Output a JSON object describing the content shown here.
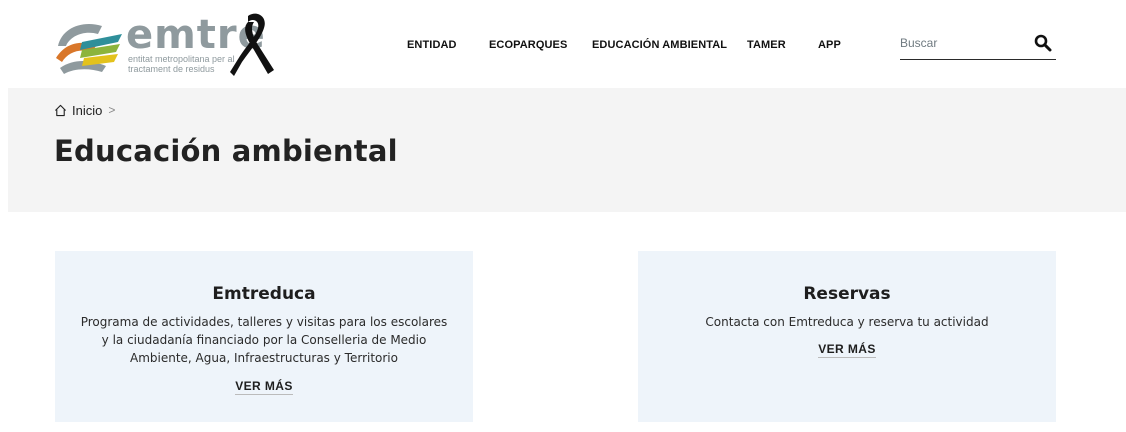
{
  "brand": {
    "name": "emtre",
    "tagline": "entitat metropolitana per al tractament de residus",
    "colors": {
      "gray": "#8f9a9e",
      "green": "#8cb43c",
      "orange": "#d9772a",
      "teal": "#2f8f9a",
      "yellow": "#e3c21c",
      "ribbon": "#111111"
    }
  },
  "nav": {
    "items": [
      {
        "label": "ENTIDAD"
      },
      {
        "label": "ECOPARQUES"
      },
      {
        "label": "EDUCACIÓN AMBIENTAL"
      },
      {
        "label": "TAMER"
      },
      {
        "label": "APP"
      }
    ]
  },
  "search": {
    "placeholder": "Buscar",
    "icon": "search-icon"
  },
  "breadcrumb": {
    "home_label": "Inicio",
    "separator": ">",
    "icon": "home-icon"
  },
  "page": {
    "title": "Educación ambiental"
  },
  "cards": [
    {
      "title": "Emtreduca",
      "description": "Programa de actividades, talleres y visitas para los escolares y la ciudadanía financiado por la Conselleria de Medio Ambiente, Agua, Infraestructuras y Territorio",
      "link": "VER MÁS"
    },
    {
      "title": "Reservas",
      "description": "Contacta con Emtreduca y reserva tu actividad",
      "link": "VER MÁS"
    }
  ],
  "theme": {
    "hero_bg": "#f4f4f4",
    "card_bg": "#eef4fa"
  }
}
